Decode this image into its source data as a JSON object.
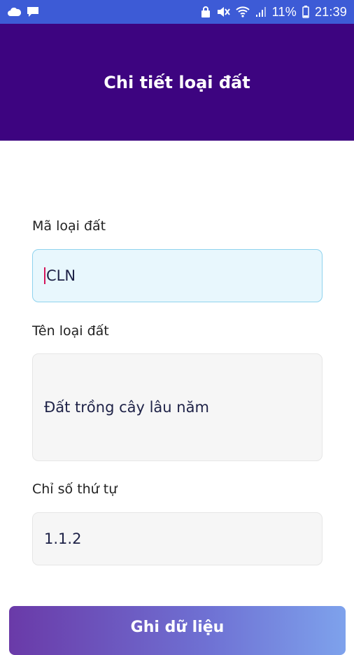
{
  "status_bar": {
    "battery_percent": "11%",
    "time": "21:39",
    "icons_left": [
      "cloud-icon",
      "message-icon"
    ],
    "icons_right": [
      "lock-icon",
      "mute-icon",
      "wifi-icon",
      "signal-icon",
      "battery-icon"
    ]
  },
  "header": {
    "title": "Chi tiết loại đất"
  },
  "form": {
    "code_label": "Mã loại đất",
    "code_value": "CLN",
    "name_label": "Tên loại đất",
    "name_value": "Đất trồng cây lâu năm",
    "order_label": "Chỉ số thứ tự",
    "order_value": "1.1.2"
  },
  "actions": {
    "save_label": "Ghi dữ liệu"
  },
  "colors": {
    "status_bar": "#3d5bd6",
    "header": "#3d0480",
    "focused_field_bg": "#e8f7fd",
    "focused_field_border": "#8fd3ee",
    "field_bg": "#f6f6f6"
  }
}
